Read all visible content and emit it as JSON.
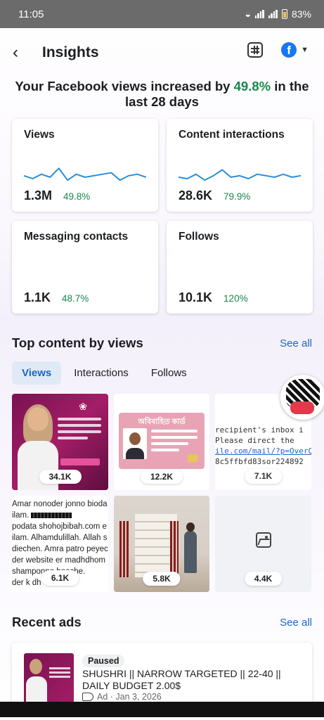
{
  "status": {
    "time": "11:05",
    "battery": "83%"
  },
  "header": {
    "title": "Insights",
    "back_icon": "back-arrow-icon",
    "table_icon": "table-icon",
    "account_icon": "facebook-icon"
  },
  "headline": {
    "prefix": "Your Facebook views increased by ",
    "pct": "49.8%",
    "suffix": " in the last 28 days"
  },
  "metrics": [
    {
      "title": "Views",
      "value": "1.3M",
      "delta": "49.8%",
      "trend": [
        0.55,
        0.45,
        0.6,
        0.5,
        0.8,
        0.4,
        0.6,
        0.5,
        0.55,
        0.6,
        0.65,
        0.4,
        0.55,
        0.6,
        0.5
      ]
    },
    {
      "title": "Content interactions",
      "value": "28.6K",
      "delta": "79.9%",
      "trend": [
        0.5,
        0.45,
        0.6,
        0.4,
        0.55,
        0.75,
        0.5,
        0.55,
        0.45,
        0.6,
        0.55,
        0.5,
        0.6,
        0.5,
        0.55
      ]
    },
    {
      "title": "Messaging contacts",
      "value": "1.1K",
      "delta": "48.7%"
    },
    {
      "title": "Follows",
      "value": "10.1K",
      "delta": "120%"
    }
  ],
  "top_content": {
    "title": "Top content by views",
    "see_all": "See all",
    "tabs": [
      "Views",
      "Interactions",
      "Follows"
    ],
    "active_tab": "Views",
    "items": [
      {
        "count": "34.1K"
      },
      {
        "count": "12.2K",
        "card_heading": "অবিবাহিত কার্ড"
      },
      {
        "count": "7.1K",
        "lines": [
          "recipient's inbox i",
          "Please direct the ",
          "ile.com/mail/?p=OverQu",
          "8c5ffbfd83sor224892"
        ]
      },
      {
        "count": "6.1K",
        "lines": [
          "Amar nonoder jonno bioda",
          "ilam.",
          "podata shohojbibah.com e",
          "ilam. Alhamdulillah. Allah s",
          "diechen. Amra patro peyec",
          "der website er madhdhom",
          "shamponno hoeche.",
          "der k dh"
        ]
      },
      {
        "count": "5.8K"
      },
      {
        "count": "4.4K"
      }
    ]
  },
  "recent_ads": {
    "title": "Recent ads",
    "see_all": "See all",
    "ad": {
      "status": "Paused",
      "name": "SHUSHRI || NARROW TARGETED || 22-40 || DAILY BUDGET 2.00$",
      "meta": "Ad · Jan 3, 2026"
    }
  },
  "colors": {
    "accent": "#1b67c2",
    "positive": "#16884a",
    "facebook": "#1877f2",
    "sparkline": "#2d8fd5"
  }
}
